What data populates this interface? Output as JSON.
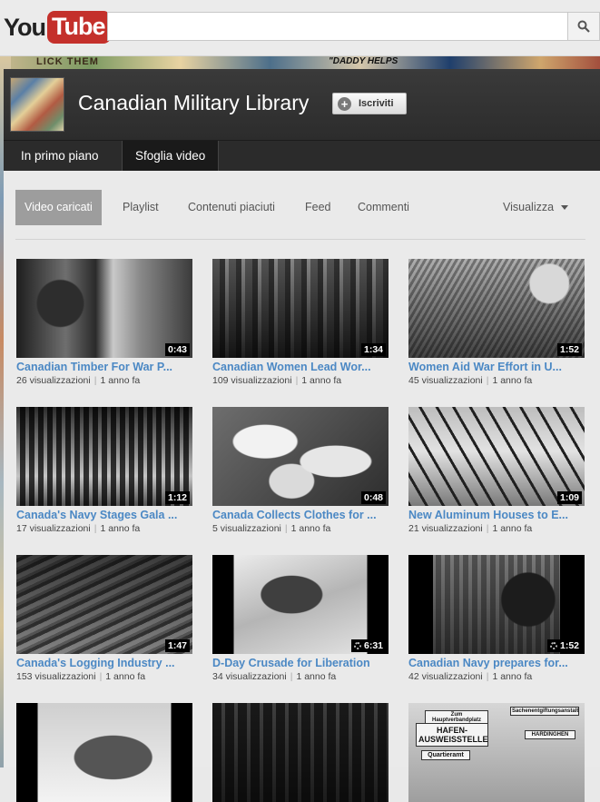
{
  "masthead": {
    "logo_you": "You",
    "logo_tube": "Tube",
    "search_placeholder": "",
    "search_icon": "search-icon"
  },
  "background": {
    "poster_text_1": "LICK THEM",
    "poster_text_2": "\"DADDY HELPS"
  },
  "channel": {
    "title": "Canadian Military Library",
    "subscribe_label": "Iscriviti"
  },
  "nav": {
    "tabs": [
      {
        "label": "In primo piano"
      },
      {
        "label": "Sfoglia video"
      }
    ],
    "active": "Sfoglia video"
  },
  "subnav": {
    "tabs": [
      {
        "label": "Video caricati"
      },
      {
        "label": "Playlist"
      },
      {
        "label": "Contenuti piaciuti"
      },
      {
        "label": "Feed"
      },
      {
        "label": "Commenti"
      }
    ],
    "view_label": "Visualizza"
  },
  "videos": [
    {
      "title": "Canadian Timber For War P...",
      "duration": "0:43",
      "views": "26 visualizzazioni",
      "age": "1 anno fa",
      "hd": false
    },
    {
      "title": "Canadian Women Lead Wor...",
      "duration": "1:34",
      "views": "109 visualizzazioni",
      "age": "1 anno fa",
      "hd": false
    },
    {
      "title": "Women Aid War Effort in U...",
      "duration": "1:52",
      "views": "45 visualizzazioni",
      "age": "1 anno fa",
      "hd": false
    },
    {
      "title": "Canada's Navy Stages Gala ...",
      "duration": "1:12",
      "views": "17 visualizzazioni",
      "age": "1 anno fa",
      "hd": false
    },
    {
      "title": "Canada Collects Clothes for ...",
      "duration": "0:48",
      "views": "5 visualizzazioni",
      "age": "1 anno fa",
      "hd": false
    },
    {
      "title": "New Aluminum Houses to E...",
      "duration": "1:09",
      "views": "21 visualizzazioni",
      "age": "1 anno fa",
      "hd": false
    },
    {
      "title": "Canada's Logging Industry ...",
      "duration": "1:47",
      "views": "153 visualizzazioni",
      "age": "1 anno fa",
      "hd": false
    },
    {
      "title": "D-Day Crusade for Liberation",
      "duration": "6:31",
      "views": "34 visualizzazioni",
      "age": "1 anno fa",
      "hd": true
    },
    {
      "title": "Canadian Navy prepares for...",
      "duration": "1:52",
      "views": "42 visualizzazioni",
      "age": "1 anno fa",
      "hd": true
    }
  ],
  "partial_row_signs": {
    "sign_1": "Zum Hauptverbandplatz",
    "sign_2": "HAFEN-AUSWEISSTELLE",
    "sign_3": "Quartieramt",
    "sign_4": "Sachenentgiftungsanstalt",
    "sign_5": "HARDINGHEN"
  }
}
